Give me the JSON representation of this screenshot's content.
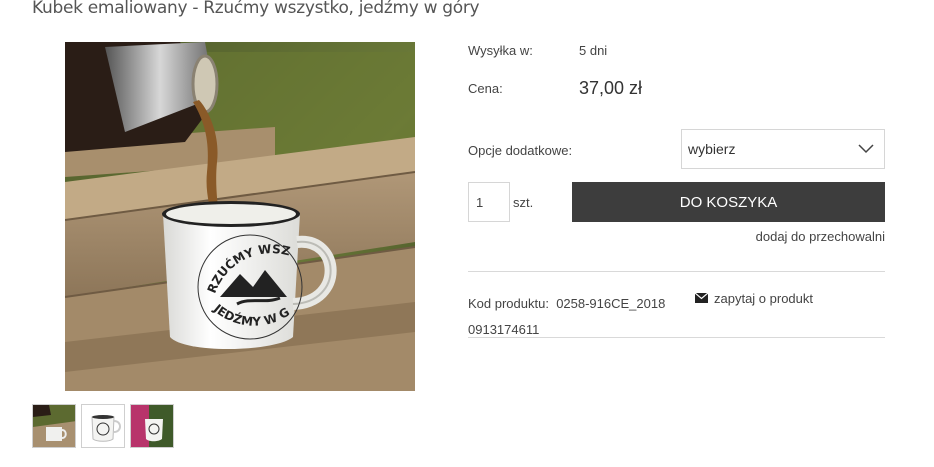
{
  "product": {
    "title": "Kubek emaliowany - Rzućmy wszystko, jedźmy w góry",
    "image_alt": "Kubek emaliowany z napisem Rzućmy wszystko jedźmy w góry",
    "mug_text_top": "RZUĆMY WSZYSTKO",
    "mug_text_bottom": "JEDŹMY W GÓRY"
  },
  "thumbnails": [
    {
      "name": "thumbnail-1"
    },
    {
      "name": "thumbnail-2"
    },
    {
      "name": "thumbnail-3"
    }
  ],
  "shipping": {
    "label": "Wysyłka w:",
    "value": "5 dni"
  },
  "price": {
    "label": "Cena:",
    "value": "37,00 zł"
  },
  "options": {
    "label": "Opcje dodatkowe:",
    "selected": "wybierz"
  },
  "quantity": {
    "value": "1",
    "unit": "szt."
  },
  "cart_button": {
    "label": "DO KOSZYKA"
  },
  "storage_link": {
    "label": "dodaj do przechowalni"
  },
  "product_code": {
    "label": "Kod produktu:",
    "value": "0258-916CE_20180913174611"
  },
  "ask_link": {
    "label": "zapytaj o produkt",
    "icon": "envelope-icon"
  },
  "colors": {
    "button_bg": "#3d3d3d",
    "border": "#d6d6d6"
  }
}
